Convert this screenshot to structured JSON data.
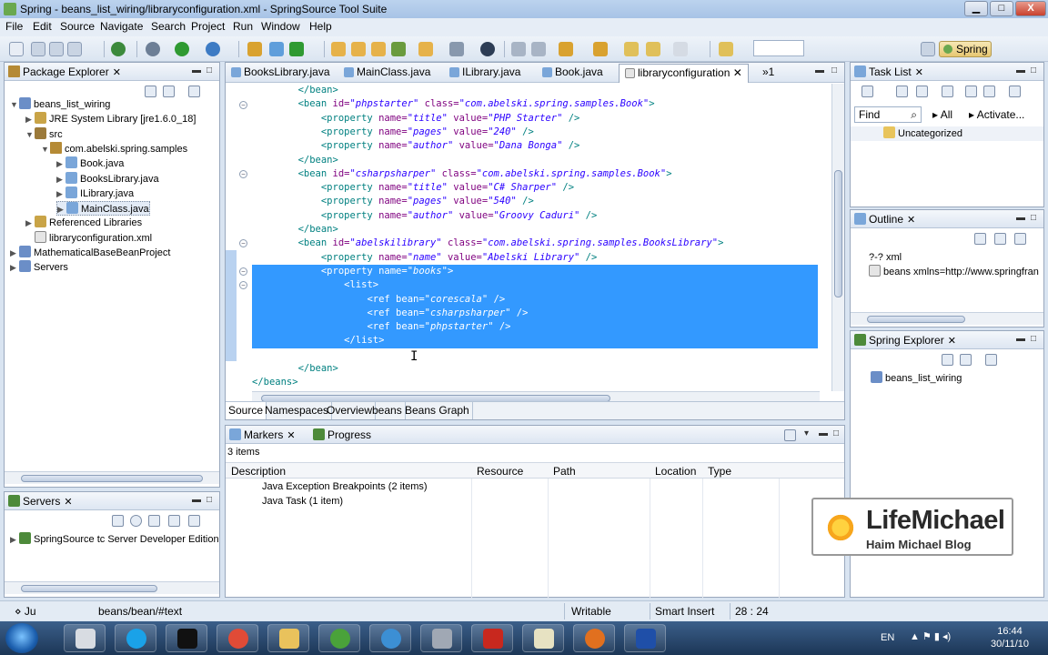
{
  "window": {
    "title": "Spring - beans_list_wiring/libraryconfiguration.xml - SpringSource Tool Suite",
    "controls": {
      "minimize": "▁",
      "maximize": "□",
      "close": "X"
    }
  },
  "menu": [
    "File",
    "Edit",
    "Source",
    "Navigate",
    "Search",
    "Project",
    "Run",
    "Window",
    "Help"
  ],
  "perspective": {
    "label": "Spring"
  },
  "package_explorer": {
    "title": "Package Explorer",
    "items": [
      {
        "label": "beans_list_wiring",
        "icon": "project-icon",
        "level": 1,
        "expander": "▼"
      },
      {
        "label": "JRE System Library [jre1.6.0_18]",
        "icon": "library-icon",
        "level": 2,
        "expander": "▶"
      },
      {
        "label": "src",
        "icon": "source-folder-icon",
        "level": 2,
        "expander": "▼"
      },
      {
        "label": "com.abelski.spring.samples",
        "icon": "package-icon",
        "level": 3,
        "expander": "▼"
      },
      {
        "label": "Book.java",
        "icon": "java-file-icon",
        "level": 4,
        "expander": "▶"
      },
      {
        "label": "BooksLibrary.java",
        "icon": "java-file-icon",
        "level": 4,
        "expander": "▶"
      },
      {
        "label": "ILibrary.java",
        "icon": "java-file-icon",
        "level": 4,
        "expander": "▶"
      },
      {
        "label": "MainClass.java",
        "icon": "java-file-icon",
        "level": 4,
        "expander": "▶",
        "selected": true
      },
      {
        "label": "Referenced Libraries",
        "icon": "library-icon",
        "level": 2,
        "expander": "▶"
      },
      {
        "label": "libraryconfiguration.xml",
        "icon": "xml-file-icon",
        "level": 2,
        "expander": ""
      },
      {
        "label": "MathematicalBaseBeanProject",
        "icon": "project-icon",
        "level": 1,
        "expander": "▶"
      },
      {
        "label": "Servers",
        "icon": "project-icon",
        "level": 1,
        "expander": "▶"
      }
    ]
  },
  "servers": {
    "title": "Servers",
    "items": [
      {
        "label": "SpringSource tc Server Developer Edition"
      }
    ]
  },
  "editor": {
    "tabs": [
      {
        "label": "BooksLibrary.java",
        "active": false
      },
      {
        "label": "MainClass.java",
        "active": false
      },
      {
        "label": "ILibrary.java",
        "active": false
      },
      {
        "label": "Book.java",
        "active": false
      },
      {
        "label": "libraryconfiguration",
        "active": true
      }
    ],
    "overflow": "»1",
    "bottom_tabs": [
      "Source",
      "Namespaces",
      "Overview",
      "beans",
      "Beans Graph"
    ],
    "code_lines": [
      {
        "indent": "        ",
        "parts": [
          {
            "c": "tg",
            "t": "</bean>"
          }
        ]
      },
      {
        "indent": "        ",
        "parts": [
          {
            "c": "tg",
            "t": "<bean "
          },
          {
            "c": "an",
            "t": "id="
          },
          {
            "c": "av",
            "t": "\"phpstarter\""
          },
          {
            "c": "an",
            "t": " class="
          },
          {
            "c": "av",
            "t": "\"com.abelski.spring.samples.Book\""
          },
          {
            "c": "tg",
            "t": ">"
          }
        ]
      },
      {
        "indent": "            ",
        "parts": [
          {
            "c": "tg",
            "t": "<property "
          },
          {
            "c": "an",
            "t": "name="
          },
          {
            "c": "av",
            "t": "\"title\""
          },
          {
            "c": "an",
            "t": " value="
          },
          {
            "c": "av",
            "t": "\"PHP Starter\""
          },
          {
            "c": "tg",
            "t": " />"
          }
        ]
      },
      {
        "indent": "            ",
        "parts": [
          {
            "c": "tg",
            "t": "<property "
          },
          {
            "c": "an",
            "t": "name="
          },
          {
            "c": "av",
            "t": "\"pages\""
          },
          {
            "c": "an",
            "t": " value="
          },
          {
            "c": "av",
            "t": "\"240\""
          },
          {
            "c": "tg",
            "t": " />"
          }
        ]
      },
      {
        "indent": "            ",
        "parts": [
          {
            "c": "tg",
            "t": "<property "
          },
          {
            "c": "an",
            "t": "name="
          },
          {
            "c": "av",
            "t": "\"author\""
          },
          {
            "c": "an",
            "t": " value="
          },
          {
            "c": "av",
            "t": "\"Dana Bonga\""
          },
          {
            "c": "tg",
            "t": " />"
          }
        ]
      },
      {
        "indent": "        ",
        "parts": [
          {
            "c": "tg",
            "t": "</bean>"
          }
        ]
      },
      {
        "indent": "        ",
        "parts": [
          {
            "c": "tg",
            "t": "<bean "
          },
          {
            "c": "an",
            "t": "id="
          },
          {
            "c": "av",
            "t": "\"csharpsharper\""
          },
          {
            "c": "an",
            "t": " class="
          },
          {
            "c": "av",
            "t": "\"com.abelski.spring.samples.Book\""
          },
          {
            "c": "tg",
            "t": ">"
          }
        ]
      },
      {
        "indent": "            ",
        "parts": [
          {
            "c": "tg",
            "t": "<property "
          },
          {
            "c": "an",
            "t": "name="
          },
          {
            "c": "av",
            "t": "\"title\""
          },
          {
            "c": "an",
            "t": " value="
          },
          {
            "c": "av",
            "t": "\"C# Sharper\""
          },
          {
            "c": "tg",
            "t": " />"
          }
        ]
      },
      {
        "indent": "            ",
        "parts": [
          {
            "c": "tg",
            "t": "<property "
          },
          {
            "c": "an",
            "t": "name="
          },
          {
            "c": "av",
            "t": "\"pages\""
          },
          {
            "c": "an",
            "t": " value="
          },
          {
            "c": "av",
            "t": "\"540\""
          },
          {
            "c": "tg",
            "t": " />"
          }
        ]
      },
      {
        "indent": "            ",
        "parts": [
          {
            "c": "tg",
            "t": "<property "
          },
          {
            "c": "an",
            "t": "name="
          },
          {
            "c": "av",
            "t": "\"author\""
          },
          {
            "c": "an",
            "t": " value="
          },
          {
            "c": "av",
            "t": "\"Groovy Caduri\""
          },
          {
            "c": "tg",
            "t": " />"
          }
        ]
      },
      {
        "indent": "        ",
        "parts": [
          {
            "c": "tg",
            "t": "</bean>"
          }
        ]
      },
      {
        "indent": "        ",
        "parts": [
          {
            "c": "tg",
            "t": "<bean "
          },
          {
            "c": "an",
            "t": "id="
          },
          {
            "c": "av",
            "t": "\"abelskilibrary\""
          },
          {
            "c": "an",
            "t": " class="
          },
          {
            "c": "av",
            "t": "\"com.abelski.spring.samples.BooksLibrary\""
          },
          {
            "c": "tg",
            "t": ">"
          }
        ]
      },
      {
        "indent": "            ",
        "parts": [
          {
            "c": "tg",
            "t": "<property "
          },
          {
            "c": "an",
            "t": "name="
          },
          {
            "c": "av",
            "t": "\"name\""
          },
          {
            "c": "an",
            "t": " value="
          },
          {
            "c": "av",
            "t": "\"Abelski Library\""
          },
          {
            "c": "tg",
            "t": " />"
          }
        ]
      },
      {
        "indent": "            ",
        "sel": true,
        "parts": [
          {
            "c": "tg",
            "t": "<property "
          },
          {
            "c": "an",
            "t": "name="
          },
          {
            "c": "av",
            "t": "\"books\""
          },
          {
            "c": "tg",
            "t": ">"
          }
        ]
      },
      {
        "indent": "                ",
        "sel": true,
        "parts": [
          {
            "c": "tg",
            "t": "<list>"
          }
        ]
      },
      {
        "indent": "                    ",
        "sel": true,
        "parts": [
          {
            "c": "tg",
            "t": "<ref "
          },
          {
            "c": "an",
            "t": "bean="
          },
          {
            "c": "av",
            "t": "\"corescala\""
          },
          {
            "c": "tg",
            "t": " />"
          }
        ]
      },
      {
        "indent": "                    ",
        "sel": true,
        "parts": [
          {
            "c": "tg",
            "t": "<ref "
          },
          {
            "c": "an",
            "t": "bean="
          },
          {
            "c": "av",
            "t": "\"csharpsharper\""
          },
          {
            "c": "tg",
            "t": " />"
          }
        ]
      },
      {
        "indent": "                    ",
        "sel": true,
        "parts": [
          {
            "c": "tg",
            "t": "<ref "
          },
          {
            "c": "an",
            "t": "bean="
          },
          {
            "c": "av",
            "t": "\"phpstarter\""
          },
          {
            "c": "tg",
            "t": " />"
          }
        ]
      },
      {
        "indent": "                ",
        "sel": true,
        "parts": [
          {
            "c": "tg",
            "t": "</list>"
          }
        ]
      },
      {
        "indent": "            ",
        "sel": true,
        "parts": [
          {
            "c": "tg",
            "t": "</property>"
          }
        ]
      },
      {
        "indent": "        ",
        "parts": [
          {
            "c": "tg",
            "t": "</bean>"
          }
        ]
      },
      {
        "indent": "",
        "parts": [
          {
            "c": "tg",
            "t": "</beans>"
          }
        ]
      }
    ]
  },
  "markers": {
    "tabs": [
      {
        "label": "Markers"
      },
      {
        "label": "Progress"
      }
    ],
    "count": "3 items",
    "columns": [
      "Description",
      "Resource",
      "Path",
      "Location",
      "Type"
    ],
    "rows": [
      {
        "description": "Java Exception Breakpoints (2 items)"
      },
      {
        "description": "Java Task (1 item)"
      }
    ]
  },
  "task_list": {
    "title": "Task List",
    "find_placeholder": "Find",
    "all_label": "All",
    "activate_label": "Activate...",
    "items": [
      {
        "label": "Uncategorized"
      }
    ]
  },
  "outline": {
    "title": "Outline",
    "items": [
      {
        "label": "?-? xml"
      },
      {
        "label": "beans xmlns=http://www.springfran"
      }
    ]
  },
  "spring_explorer": {
    "title": "Spring Explorer",
    "items": [
      {
        "label": "beans_list_wiring"
      }
    ]
  },
  "status": {
    "path": "beans/bean/#text",
    "mode": "Writable",
    "insert": "Smart Insert",
    "position": "28 : 24"
  },
  "watermark": {
    "brand": "LifeMichael",
    "tagline": "Haim Michael Blog"
  },
  "taskbar": {
    "lang": "EN",
    "time": "16:44",
    "date": "30/11/10"
  },
  "colors": {
    "selection": "#3399ff",
    "accent": "#6aa84f"
  }
}
